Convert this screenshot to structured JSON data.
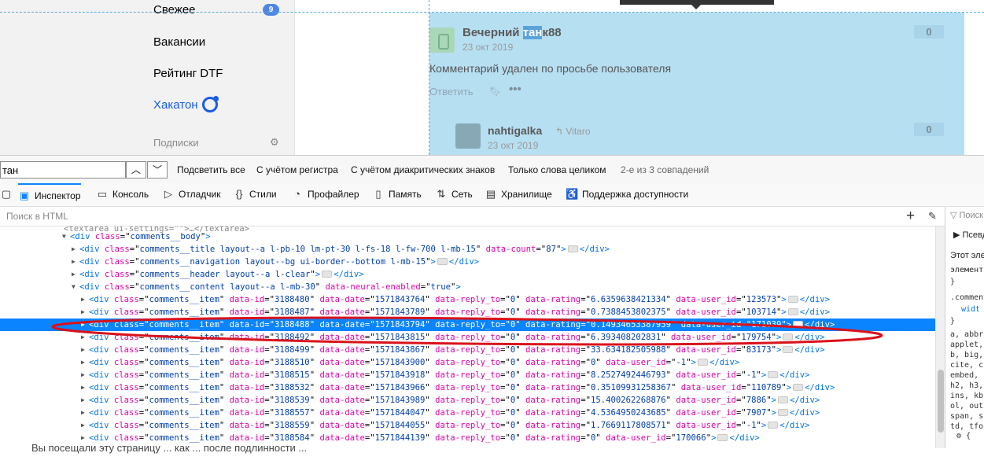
{
  "sidebar": {
    "items": [
      {
        "label": "Свежее",
        "badge": "9"
      },
      {
        "label": "Вакансии"
      },
      {
        "label": "Рейтинг DTF"
      },
      {
        "label": "Хакатон"
      }
    ],
    "subscriptions_label": "Подписки"
  },
  "comments": [
    {
      "author_prefix": "Вечерний ",
      "author_highlight": "тан",
      "author_suffix": "к88",
      "date": "23 окт 2019",
      "rating": "0",
      "text": "Комментарий удален по просьбе пользователя",
      "reply_label": "Ответить"
    },
    {
      "author": "nahtigalka",
      "reply_to": "Vitaro",
      "date": "23 окт 2019",
      "rating": "0"
    }
  ],
  "findbar": {
    "query": "тан",
    "options": [
      "Подсветить все",
      "С учётом регистра",
      "С учётом диакритических знаков",
      "Только слова целиком"
    ],
    "status": "2-е из 3 совпадений"
  },
  "tabs": [
    {
      "label": "Инспектор",
      "active": true,
      "icon": "inspector-icon"
    },
    {
      "label": "Консоль",
      "icon": "console-icon"
    },
    {
      "label": "Отладчик",
      "icon": "debugger-icon"
    },
    {
      "label": "Стили",
      "icon": "style-editor-icon"
    },
    {
      "label": "Профайлер",
      "icon": "profiler-icon"
    },
    {
      "label": "Память",
      "icon": "memory-icon"
    },
    {
      "label": "Сеть",
      "icon": "network-icon"
    },
    {
      "label": "Хранилище",
      "icon": "storage-icon"
    },
    {
      "label": "Поддержка доступности",
      "icon": "accessibility-icon"
    }
  ],
  "html_search_placeholder": "Поиск в HTML",
  "markup": {
    "line0": "<textarea ui-settings=\"\">…</textarea>",
    "body_open": {
      "tag": "div",
      "class": "comments__body"
    },
    "title": {
      "class": "comments__title layout--a l-pb-10 lm-pt-30 l-fs-18 l-fw-700 l-mb-15",
      "data_count": "87"
    },
    "navigation": {
      "class": "comments__navigation layout--bg ui-border--bottom l-mb-15"
    },
    "header": {
      "class": "comments__header layout--a l-clear"
    },
    "content": {
      "class": "comments__content layout--a l-mb-30",
      "data_neural_enabled": "true"
    },
    "item_class": "comments__item",
    "items": [
      {
        "id": "3188480",
        "date": "1571843764",
        "reply_to": "0",
        "rating": "6.6359638421334",
        "user": "123573"
      },
      {
        "id": "3188487",
        "date": "1571843789",
        "reply_to": "0",
        "rating": "0.7388453802375",
        "user": "103714"
      },
      {
        "id": "3188488",
        "date": "1571843794",
        "reply_to": "0",
        "rating": "0.14934653387959",
        "user": "171039"
      },
      {
        "id": "3188492",
        "date": "1571843815",
        "reply_to": "0",
        "rating": "6.393408202831",
        "user": "179754"
      },
      {
        "id": "3188499",
        "date": "1571843867",
        "reply_to": "0",
        "rating": "33.634182505988",
        "user": "83173"
      },
      {
        "id": "3188510",
        "date": "1571843900",
        "reply_to": "0",
        "rating": "0",
        "user": "-1"
      },
      {
        "id": "3188515",
        "date": "1571843918",
        "reply_to": "0",
        "rating": "8.2527492446793",
        "user": "-1"
      },
      {
        "id": "3188532",
        "date": "1571843966",
        "reply_to": "0",
        "rating": "0.35109931258367",
        "user": "110789"
      },
      {
        "id": "3188539",
        "date": "1571843989",
        "reply_to": "0",
        "rating": "15.400262268876",
        "user": "7886"
      },
      {
        "id": "3188557",
        "date": "1571844047",
        "reply_to": "0",
        "rating": "4.5364950243685",
        "user": "7907"
      },
      {
        "id": "3188559",
        "date": "1571844055",
        "reply_to": "0",
        "rating": "1.7669117808571",
        "user": "-1"
      },
      {
        "id": "3188584",
        "date": "1571844139",
        "reply_to": "0",
        "rating": "0",
        "user": "170066"
      }
    ]
  },
  "rules_panel": {
    "filter": "Поиск",
    "pseudo": "Псевдо",
    "this_element": "Этот эле",
    "element_label": "элемент",
    "brace_close": "}",
    "selector": ".comment",
    "prop": "widt",
    "inherited": [
      "a, abbr",
      "applet,",
      "b, big,",
      "cite, c",
      "embed,",
      "h2, h3,",
      "ins, kb",
      "ol, out",
      "span, s",
      "td, tfo"
    ]
  },
  "ghost_text": "Вы посещали эту страницу ... как ... после подлинности ...",
  "colors": {
    "selection": "#0a84ff",
    "highlight": "#b7dff2",
    "accent": "#1a5ce6",
    "annotation": "#d9121b"
  }
}
